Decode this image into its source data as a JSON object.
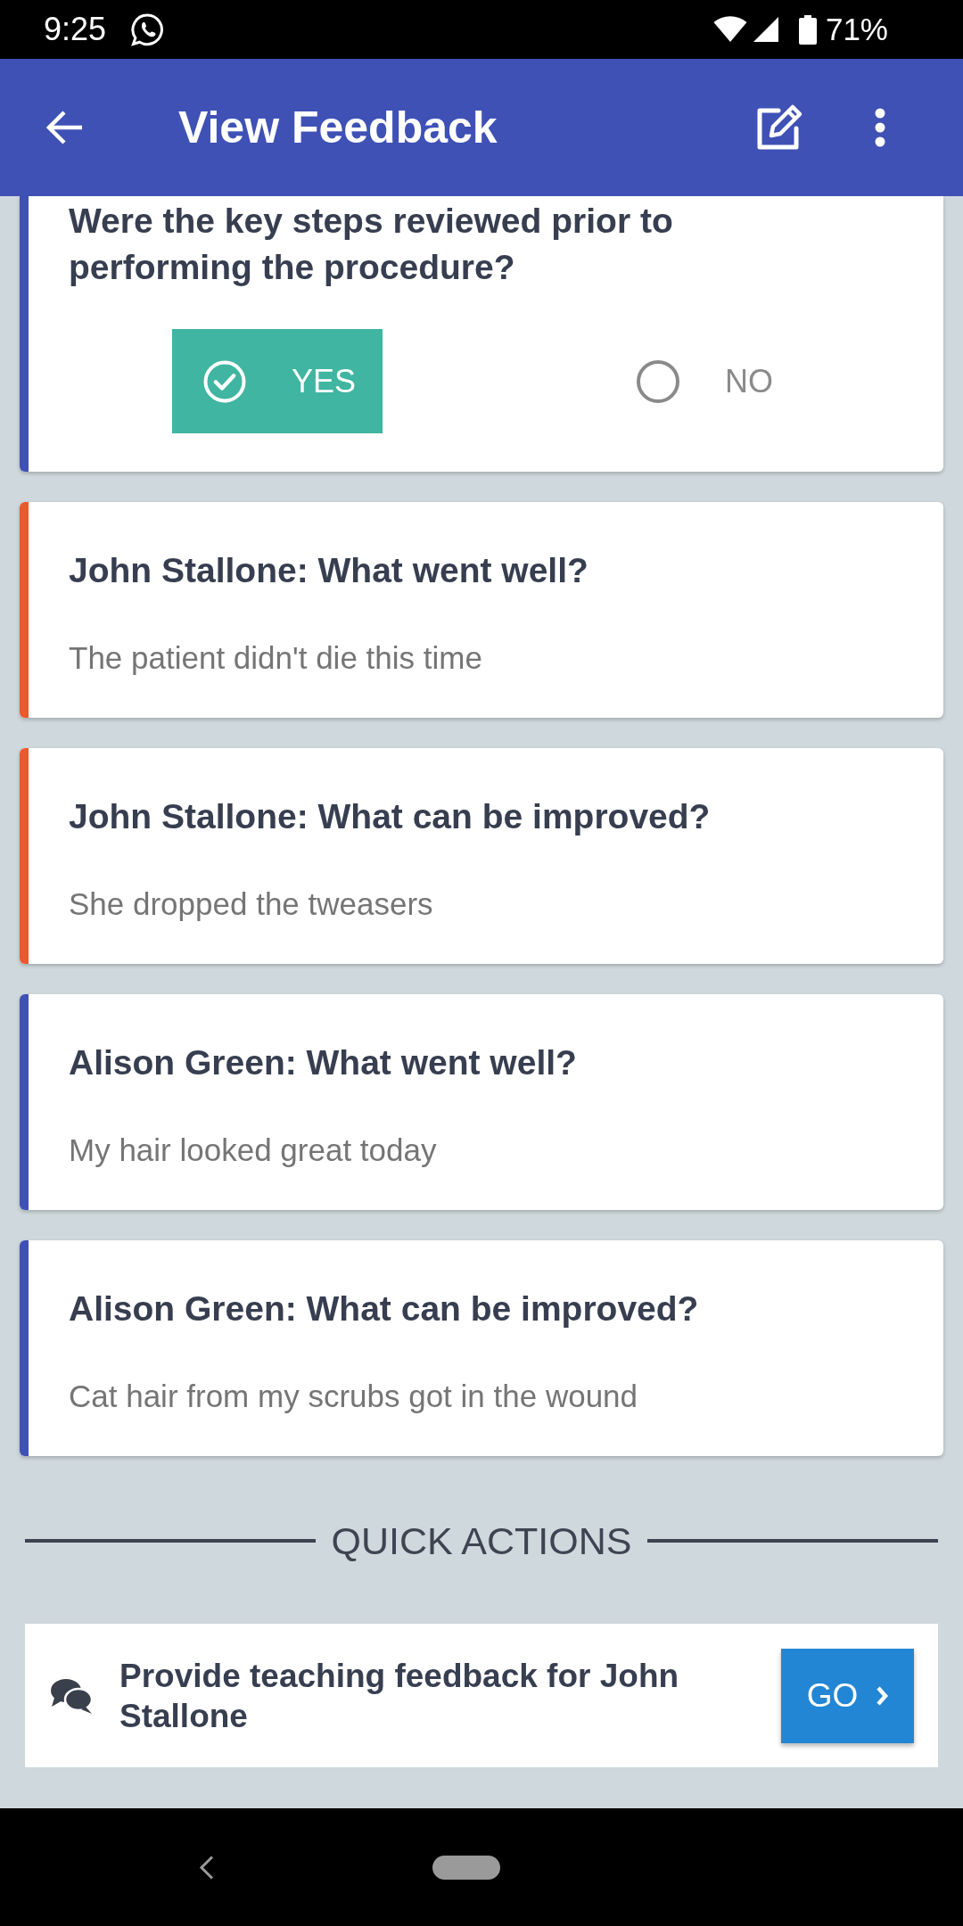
{
  "status_bar": {
    "time": "9:25",
    "battery": "71%"
  },
  "app_bar": {
    "title": "View Feedback"
  },
  "cards": [
    {
      "kind": "question",
      "color": "#3f51b5",
      "question": "Were the key steps reviewed prior to performing the procedure?",
      "options": [
        {
          "label": "YES",
          "selected": true
        },
        {
          "label": "NO",
          "selected": false
        }
      ]
    },
    {
      "kind": "feedback",
      "color": "#e95a2c",
      "title": "John Stallone: What went well?",
      "answer": "The patient didn't die this time"
    },
    {
      "kind": "feedback",
      "color": "#e95a2c",
      "title": "John Stallone: What can be improved?",
      "answer": "She dropped the tweasers"
    },
    {
      "kind": "feedback",
      "color": "#3f51b5",
      "title": "Alison Green: What went well?",
      "answer": "My hair looked great today"
    },
    {
      "kind": "feedback",
      "color": "#3f51b5",
      "title": "Alison Green: What can be improved?",
      "answer": "Cat hair from my scrubs got in the wound"
    }
  ],
  "quick_actions": {
    "heading": "QUICK ACTIONS",
    "items": [
      {
        "text": "Provide teaching feedback for John Stallone",
        "button": "GO"
      }
    ]
  }
}
